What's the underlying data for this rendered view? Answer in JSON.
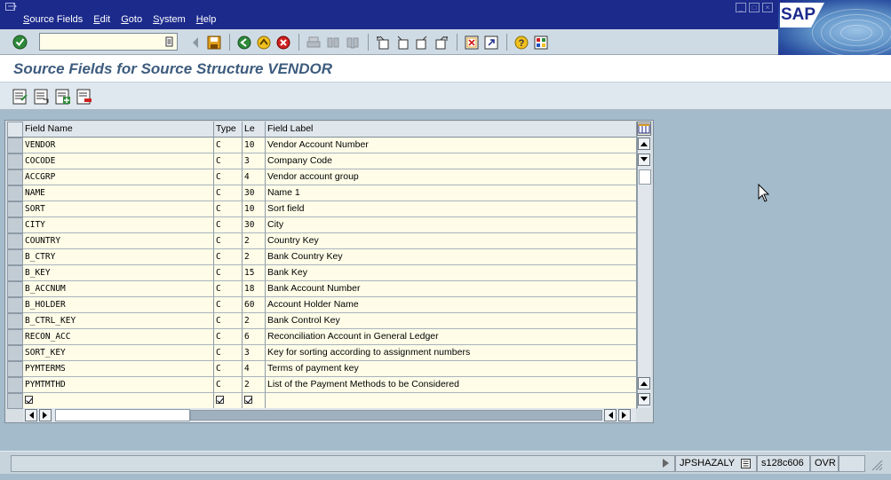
{
  "menu": [
    "Source Fields",
    "Edit",
    "Goto",
    "System",
    "Help"
  ],
  "menu_underline": [
    "S",
    "E",
    "G",
    "S",
    "H"
  ],
  "logo_text": "SAP",
  "command_field": {
    "value": ""
  },
  "title": "Source Fields for Source Structure VENDOR",
  "table": {
    "columns": [
      "Field Name",
      "Type",
      "Le",
      "Field Label"
    ],
    "rows": [
      [
        "VENDOR",
        "C",
        "10",
        "Vendor Account Number"
      ],
      [
        "COCODE",
        "C",
        "3",
        "Company Code"
      ],
      [
        "ACCGRP",
        "C",
        "4",
        "Vendor account group"
      ],
      [
        "NAME",
        "C",
        "30",
        "Name 1"
      ],
      [
        "SORT",
        "C",
        "10",
        "Sort field"
      ],
      [
        "CITY",
        "C",
        "30",
        "City"
      ],
      [
        "COUNTRY",
        "C",
        "2",
        "Country Key"
      ],
      [
        "B_CTRY",
        "C",
        "2",
        "Bank Country Key"
      ],
      [
        "B_KEY",
        "C",
        "15",
        "Bank Key"
      ],
      [
        "B_ACCNUM",
        "C",
        "18",
        "Bank Account Number"
      ],
      [
        "B_HOLDER",
        "C",
        "60",
        "Account Holder Name"
      ],
      [
        "B_CTRL_KEY",
        "C",
        "2",
        "Bank Control Key"
      ],
      [
        "RECON_ACC",
        "C",
        "6",
        "Reconciliation Account in General Ledger"
      ],
      [
        "SORT_KEY",
        "C",
        "3",
        "Key for sorting according to assignment numbers"
      ],
      [
        "PYMTERMS",
        "C",
        "4",
        "Terms of payment key"
      ],
      [
        "PYMTMTHD",
        "C",
        "2",
        "List of the Payment Methods to be Considered"
      ]
    ]
  },
  "status": {
    "user": "JPSHAZALY",
    "server": "s128c606",
    "mode": "OVR"
  },
  "colors": {
    "menubar": "#1c2a8c",
    "title": "#3e5c7e",
    "cell_bg": "#fffde8",
    "page_bg": "#a4bbcc"
  }
}
